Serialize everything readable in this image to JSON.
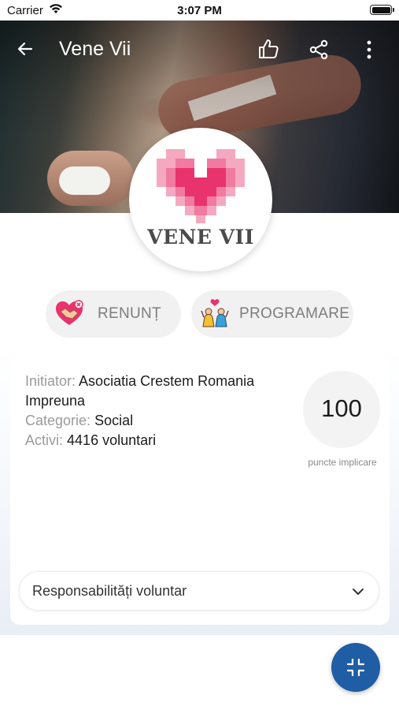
{
  "status_bar": {
    "carrier": "Carrier",
    "time": "3:07 PM"
  },
  "header": {
    "title": "Vene Vii"
  },
  "icons": {
    "back": "arrow-back-icon",
    "like": "thumbs-up-icon",
    "share": "share-icon",
    "more": "more-vertical-icon",
    "renunt": "heart-handshake-icon",
    "programare": "people-heart-icon",
    "dropdown": "chevron-down-icon",
    "fab": "collapse-icon"
  },
  "logo": {
    "text": "VENE VII"
  },
  "actions": {
    "renunt_label": "RENUNȚ",
    "programare_label": "PROGRAMARE"
  },
  "info": {
    "initiator_key": "Initiator:",
    "initiator_value": "Asociatia Crestem Romania Impreuna",
    "categorie_key": "Categorie:",
    "categorie_value": "Social",
    "activi_key": "Activi:",
    "activi_value": "4416 voluntari"
  },
  "points": {
    "value": "100",
    "label": "puncte implicare"
  },
  "dropdown": {
    "label": "Responsabilități voluntar"
  },
  "colors": {
    "fab": "#1f5ea5",
    "heart_primary": "#e8336d",
    "heart_light": "#f5a9c0"
  }
}
